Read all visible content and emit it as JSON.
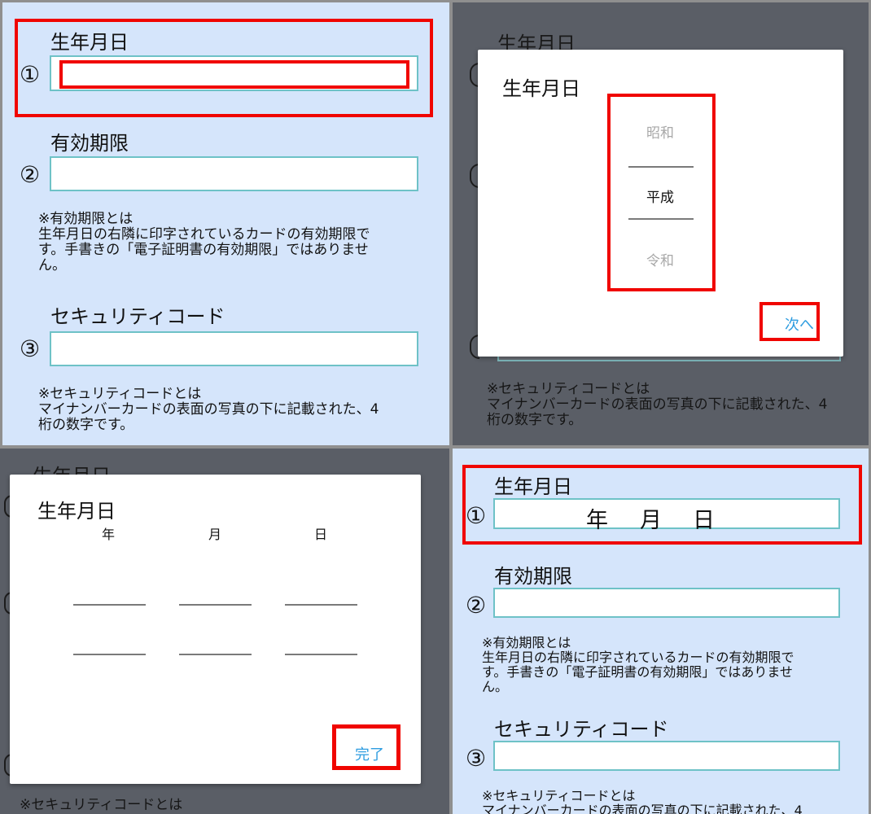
{
  "form": {
    "birthdate_label": "生年月日",
    "expiry_label": "有効期限",
    "security_label": "セキュリティコード",
    "num1": "①",
    "num2": "②",
    "num3": "③",
    "expiry_note": [
      "※有効期限とは",
      "生年月日の右隣に印字されているカードの有効期限で",
      "す。手書きの「電子証明書の有効期限」ではありませ",
      "ん。"
    ],
    "security_note": [
      "※セキュリティコードとは",
      "マイナンバーカードの表面の写真の下に記載された、4",
      "桁の数字です。"
    ]
  },
  "era_dialog": {
    "title": "生年月日",
    "options": [
      "昭和",
      "平成",
      "令和"
    ],
    "selected": "平成",
    "next_label": "次へ"
  },
  "date_dialog": {
    "title": "生年月日",
    "columns": [
      "年",
      "月",
      "日"
    ],
    "done_label": "完了"
  },
  "filled": {
    "year_suffix": "年",
    "month_suffix": "月",
    "day_suffix": "日"
  },
  "colors": {
    "form_bg": "#d5e5fb",
    "field_border": "#6ec2c7",
    "highlight": "#f00500",
    "link": "#2f9de0",
    "overlay": "#5a5e66"
  }
}
